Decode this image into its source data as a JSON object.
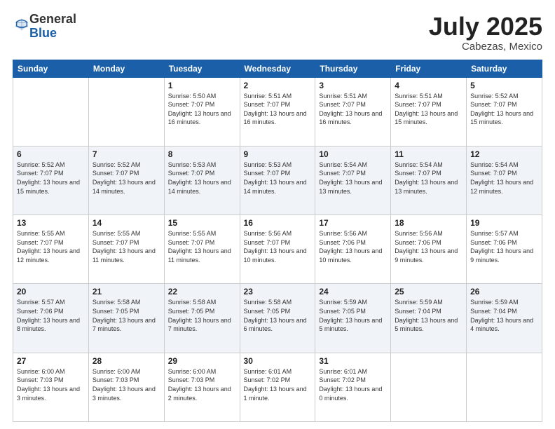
{
  "header": {
    "logo_general": "General",
    "logo_blue": "Blue",
    "month": "July 2025",
    "location": "Cabezas, Mexico"
  },
  "weekdays": [
    "Sunday",
    "Monday",
    "Tuesday",
    "Wednesday",
    "Thursday",
    "Friday",
    "Saturday"
  ],
  "weeks": [
    [
      {
        "day": "",
        "info": ""
      },
      {
        "day": "",
        "info": ""
      },
      {
        "day": "1",
        "info": "Sunrise: 5:50 AM\nSunset: 7:07 PM\nDaylight: 13 hours and 16 minutes."
      },
      {
        "day": "2",
        "info": "Sunrise: 5:51 AM\nSunset: 7:07 PM\nDaylight: 13 hours and 16 minutes."
      },
      {
        "day": "3",
        "info": "Sunrise: 5:51 AM\nSunset: 7:07 PM\nDaylight: 13 hours and 16 minutes."
      },
      {
        "day": "4",
        "info": "Sunrise: 5:51 AM\nSunset: 7:07 PM\nDaylight: 13 hours and 15 minutes."
      },
      {
        "day": "5",
        "info": "Sunrise: 5:52 AM\nSunset: 7:07 PM\nDaylight: 13 hours and 15 minutes."
      }
    ],
    [
      {
        "day": "6",
        "info": "Sunrise: 5:52 AM\nSunset: 7:07 PM\nDaylight: 13 hours and 15 minutes."
      },
      {
        "day": "7",
        "info": "Sunrise: 5:52 AM\nSunset: 7:07 PM\nDaylight: 13 hours and 14 minutes."
      },
      {
        "day": "8",
        "info": "Sunrise: 5:53 AM\nSunset: 7:07 PM\nDaylight: 13 hours and 14 minutes."
      },
      {
        "day": "9",
        "info": "Sunrise: 5:53 AM\nSunset: 7:07 PM\nDaylight: 13 hours and 14 minutes."
      },
      {
        "day": "10",
        "info": "Sunrise: 5:54 AM\nSunset: 7:07 PM\nDaylight: 13 hours and 13 minutes."
      },
      {
        "day": "11",
        "info": "Sunrise: 5:54 AM\nSunset: 7:07 PM\nDaylight: 13 hours and 13 minutes."
      },
      {
        "day": "12",
        "info": "Sunrise: 5:54 AM\nSunset: 7:07 PM\nDaylight: 13 hours and 12 minutes."
      }
    ],
    [
      {
        "day": "13",
        "info": "Sunrise: 5:55 AM\nSunset: 7:07 PM\nDaylight: 13 hours and 12 minutes."
      },
      {
        "day": "14",
        "info": "Sunrise: 5:55 AM\nSunset: 7:07 PM\nDaylight: 13 hours and 11 minutes."
      },
      {
        "day": "15",
        "info": "Sunrise: 5:55 AM\nSunset: 7:07 PM\nDaylight: 13 hours and 11 minutes."
      },
      {
        "day": "16",
        "info": "Sunrise: 5:56 AM\nSunset: 7:07 PM\nDaylight: 13 hours and 10 minutes."
      },
      {
        "day": "17",
        "info": "Sunrise: 5:56 AM\nSunset: 7:06 PM\nDaylight: 13 hours and 10 minutes."
      },
      {
        "day": "18",
        "info": "Sunrise: 5:56 AM\nSunset: 7:06 PM\nDaylight: 13 hours and 9 minutes."
      },
      {
        "day": "19",
        "info": "Sunrise: 5:57 AM\nSunset: 7:06 PM\nDaylight: 13 hours and 9 minutes."
      }
    ],
    [
      {
        "day": "20",
        "info": "Sunrise: 5:57 AM\nSunset: 7:06 PM\nDaylight: 13 hours and 8 minutes."
      },
      {
        "day": "21",
        "info": "Sunrise: 5:58 AM\nSunset: 7:05 PM\nDaylight: 13 hours and 7 minutes."
      },
      {
        "day": "22",
        "info": "Sunrise: 5:58 AM\nSunset: 7:05 PM\nDaylight: 13 hours and 7 minutes."
      },
      {
        "day": "23",
        "info": "Sunrise: 5:58 AM\nSunset: 7:05 PM\nDaylight: 13 hours and 6 minutes."
      },
      {
        "day": "24",
        "info": "Sunrise: 5:59 AM\nSunset: 7:05 PM\nDaylight: 13 hours and 5 minutes."
      },
      {
        "day": "25",
        "info": "Sunrise: 5:59 AM\nSunset: 7:04 PM\nDaylight: 13 hours and 5 minutes."
      },
      {
        "day": "26",
        "info": "Sunrise: 5:59 AM\nSunset: 7:04 PM\nDaylight: 13 hours and 4 minutes."
      }
    ],
    [
      {
        "day": "27",
        "info": "Sunrise: 6:00 AM\nSunset: 7:03 PM\nDaylight: 13 hours and 3 minutes."
      },
      {
        "day": "28",
        "info": "Sunrise: 6:00 AM\nSunset: 7:03 PM\nDaylight: 13 hours and 3 minutes."
      },
      {
        "day": "29",
        "info": "Sunrise: 6:00 AM\nSunset: 7:03 PM\nDaylight: 13 hours and 2 minutes."
      },
      {
        "day": "30",
        "info": "Sunrise: 6:01 AM\nSunset: 7:02 PM\nDaylight: 13 hours and 1 minute."
      },
      {
        "day": "31",
        "info": "Sunrise: 6:01 AM\nSunset: 7:02 PM\nDaylight: 13 hours and 0 minutes."
      },
      {
        "day": "",
        "info": ""
      },
      {
        "day": "",
        "info": ""
      }
    ]
  ]
}
